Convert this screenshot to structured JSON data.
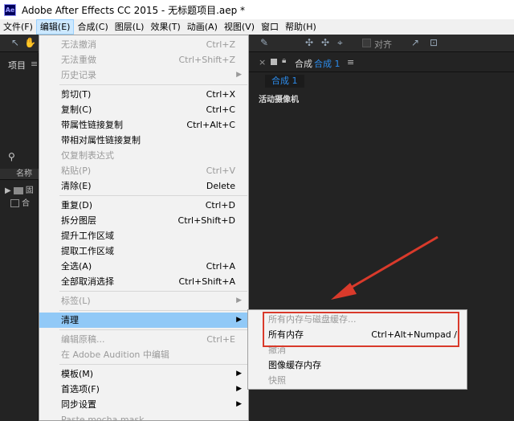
{
  "window": {
    "title": "Adobe After Effects CC 2015 - 无标题项目.aep *",
    "logo": "Ae"
  },
  "menubar": [
    "文件(F)",
    "编辑(E)",
    "合成(C)",
    "图层(L)",
    "效果(T)",
    "动画(A)",
    "视图(V)",
    "窗口",
    "帮助(H)"
  ],
  "toolbar": {
    "align_label": "对齐"
  },
  "project_panel": {
    "tab": "项目",
    "menu_icon": "≡",
    "col_name": "名称",
    "row1": "固",
    "row2": "合"
  },
  "comp_panel": {
    "close": "×",
    "title": "合成",
    "title_selected": "合成 1",
    "tab": "合成 1",
    "camera_label": "活动摄像机"
  },
  "edit_menu": {
    "undo": "无法撤消",
    "undo_sc": "Ctrl+Z",
    "redo": "无法重做",
    "redo_sc": "Ctrl+Shift+Z",
    "history": "历史记录",
    "cut": "剪切(T)",
    "cut_sc": "Ctrl+X",
    "copy": "复制(C)",
    "copy_sc": "Ctrl+C",
    "copy_prop": "带属性链接复制",
    "copy_prop_sc": "Ctrl+Alt+C",
    "copy_rel": "带相对属性链接复制",
    "copy_expr": "仅复制表达式",
    "paste": "粘贴(P)",
    "paste_sc": "Ctrl+V",
    "clear": "清除(E)",
    "clear_sc": "Delete",
    "duplicate": "重复(D)",
    "duplicate_sc": "Ctrl+D",
    "split": "拆分图层",
    "split_sc": "Ctrl+Shift+D",
    "lift": "提升工作区域",
    "extract": "提取工作区域",
    "select_all": "全选(A)",
    "select_all_sc": "Ctrl+A",
    "deselect_all": "全部取消选择",
    "deselect_all_sc": "Ctrl+Shift+A",
    "label": "标签(L)",
    "purge": "清理",
    "edit_original": "编辑原稿...",
    "edit_original_sc": "Ctrl+E",
    "audition": "在 Adobe Audition 中编辑",
    "templates": "模板(M)",
    "prefs": "首选项(F)",
    "sync": "同步设置",
    "paste_mocha": "Paste mocha mask"
  },
  "purge_submenu": {
    "all_disk": "所有内存与磁盘缓存...",
    "all_mem": "所有内存",
    "all_mem_sc": "Ctrl+Alt+Numpad /",
    "undo": "撤消",
    "image_cache": "图像缓存内存",
    "snapshot": "快照"
  },
  "colors": {
    "highlight": "#91c9f7",
    "callout_red": "#d93a2b",
    "accent_blue": "#2d8ceb"
  }
}
